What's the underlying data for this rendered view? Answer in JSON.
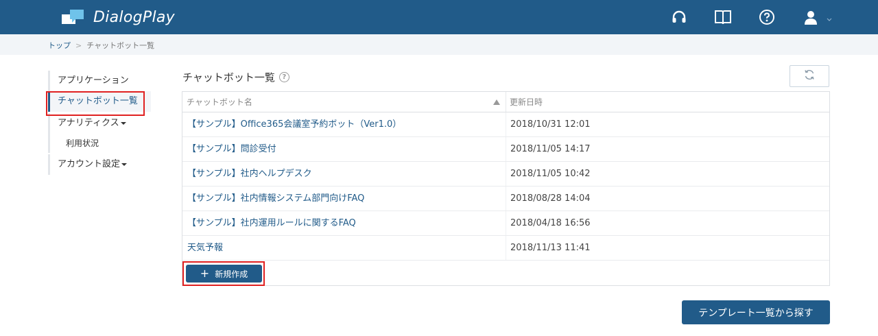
{
  "header": {
    "app_name": "DialogPlay",
    "icons": [
      "headset-icon",
      "book-icon",
      "help-icon",
      "user-icon"
    ],
    "bg_color": "#215b89"
  },
  "breadcrumb": {
    "items": [
      "トップ",
      "チャットボット一覧"
    ],
    "separator": ">"
  },
  "sidebar": {
    "items": [
      {
        "label": "アプリケーション"
      },
      {
        "label": "チャットボット一覧"
      },
      {
        "label": "アナリティクス"
      },
      {
        "label": "利用状況"
      },
      {
        "label": "アカウント設定"
      }
    ]
  },
  "main": {
    "title": "チャットボット一覧",
    "table": {
      "headers": [
        "チャットボット名",
        "更新日時"
      ],
      "rows": [
        {
          "name": "【サンプル】Office365会議室予約ボット（Ver1.0）",
          "updated": "2018/10/31 12:01"
        },
        {
          "name": "【サンプル】問診受付",
          "updated": "2018/11/05 14:17"
        },
        {
          "name": "【サンプル】社内ヘルプデスク",
          "updated": "2018/11/05 10:42"
        },
        {
          "name": "【サンプル】社内情報システム部門向けFAQ",
          "updated": "2018/08/28 14:04"
        },
        {
          "name": "【サンプル】社内運用ルールに関するFAQ",
          "updated": "2018/04/18 16:56"
        },
        {
          "name": "天気予報",
          "updated": "2018/11/13 11:41"
        }
      ]
    },
    "new_button": "新規作成",
    "template_button": "テンプレート一覧から探す"
  }
}
